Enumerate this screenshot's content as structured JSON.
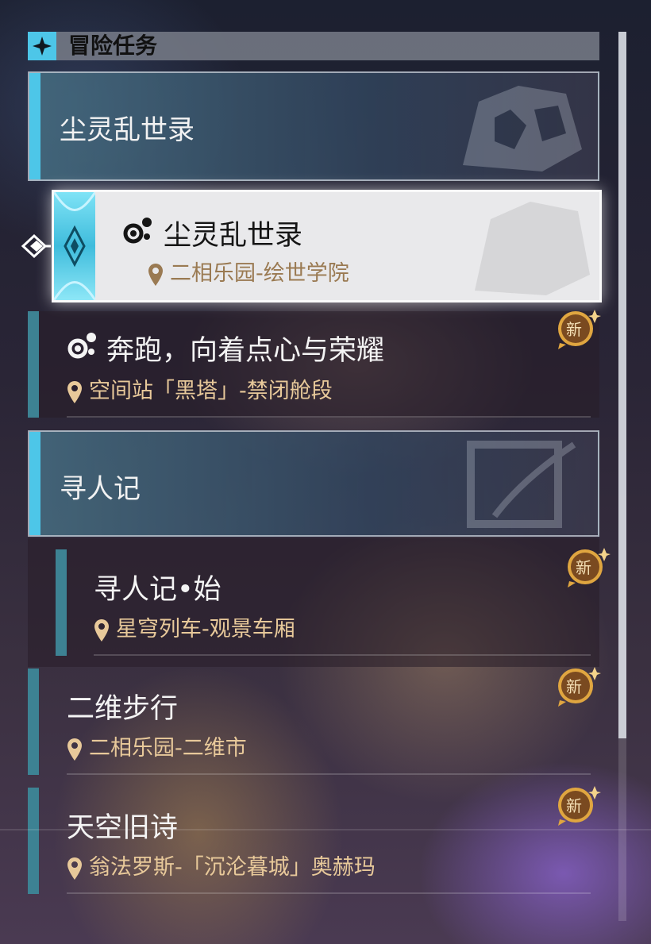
{
  "header": {
    "title": "冒险任务"
  },
  "categories": [
    {
      "title": "尘灵乱世录"
    },
    {
      "title": "寻人记"
    }
  ],
  "selected_quest": {
    "title": "尘灵乱世录",
    "location": "二相乐园-绘世学院"
  },
  "quests": [
    {
      "title": "奔跑，向着点心与荣耀",
      "location": "空间站「黑塔」-禁闭舱段",
      "badge": "新"
    },
    {
      "title": "寻人记•始",
      "location": "星穹列车-观景车厢",
      "badge": "新"
    },
    {
      "title": "二维步行",
      "location": "二相乐园-二维市",
      "badge": "新"
    },
    {
      "title": "天空旧诗",
      "location": "翁法罗斯-「沉沦暮城」奥赫玛",
      "badge": "新"
    }
  ],
  "colors": {
    "accent": "#4dc6e8",
    "badge": "#e0a640",
    "location": "#e8c99a"
  }
}
